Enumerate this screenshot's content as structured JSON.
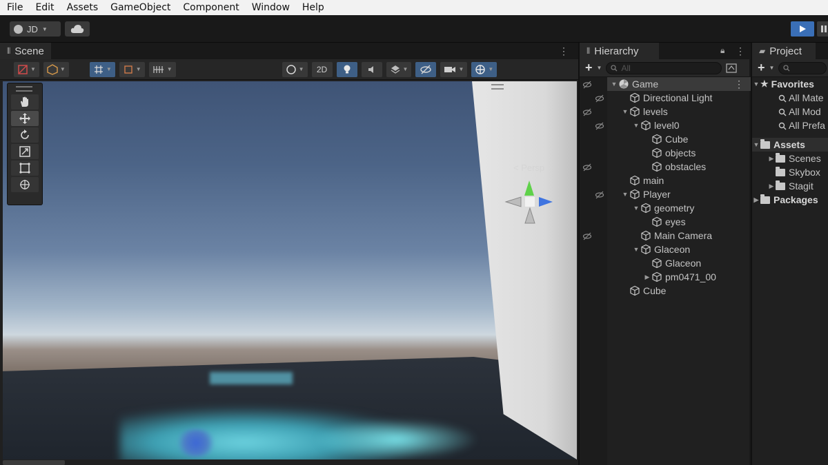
{
  "menu": [
    "File",
    "Edit",
    "Assets",
    "GameObject",
    "Component",
    "Window",
    "Help"
  ],
  "toolbar": {
    "account": "JD"
  },
  "scene": {
    "tab": "Scene",
    "btn_2d": "2D",
    "persp": "< Persp"
  },
  "hierarchy": {
    "tab": "Hierarchy",
    "search_placeholder": "All",
    "items": [
      {
        "label": "Game",
        "depth": 0,
        "expanded": true,
        "selected": true,
        "scene": true
      },
      {
        "label": "Directional Light",
        "depth": 1
      },
      {
        "label": "levels",
        "depth": 1,
        "expanded": true
      },
      {
        "label": "level0",
        "depth": 2,
        "expanded": true
      },
      {
        "label": "Cube",
        "depth": 3
      },
      {
        "label": "objects",
        "depth": 3
      },
      {
        "label": "obstacles",
        "depth": 3
      },
      {
        "label": "main",
        "depth": 1
      },
      {
        "label": "Player",
        "depth": 1,
        "expanded": true
      },
      {
        "label": "geometry",
        "depth": 2,
        "expanded": true
      },
      {
        "label": "eyes",
        "depth": 3
      },
      {
        "label": "Main Camera",
        "depth": 2
      },
      {
        "label": "Glaceon",
        "depth": 2,
        "expanded": true
      },
      {
        "label": "Glaceon",
        "depth": 3
      },
      {
        "label": "pm0471_00",
        "depth": 3,
        "collapsed": true
      },
      {
        "label": "Cube",
        "depth": 1
      }
    ]
  },
  "project": {
    "tab": "Project",
    "favorites": "Favorites",
    "fav_items": [
      "All Mate",
      "All Mod",
      "All Prefa"
    ],
    "assets": "Assets",
    "asset_items": [
      "Scenes",
      "Skybox",
      "Stagit"
    ],
    "packages": "Packages"
  },
  "colors": {
    "play_active": "#3a6fb7",
    "tool_active": "#3e5f86"
  }
}
